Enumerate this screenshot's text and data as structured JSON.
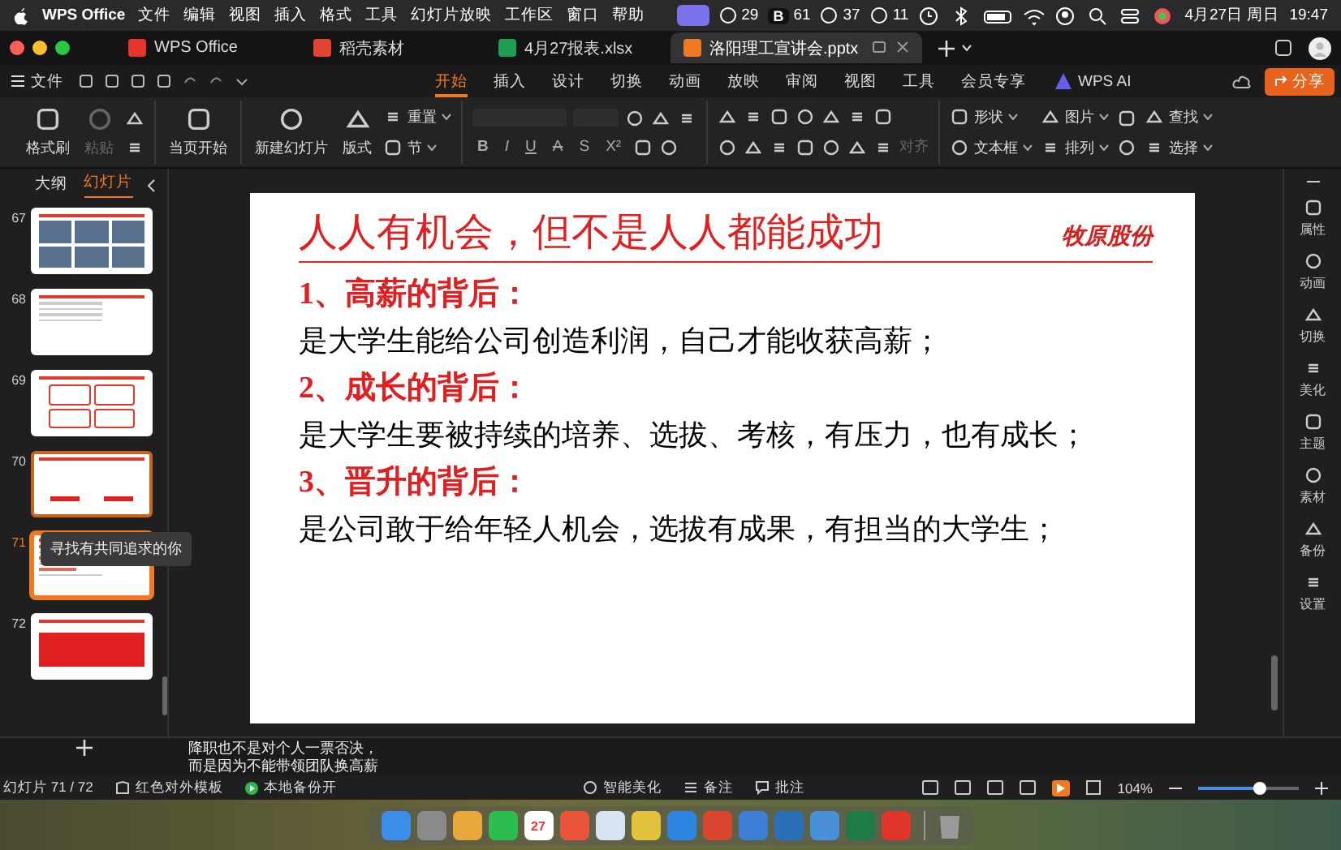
{
  "menubar": {
    "app": "WPS Office",
    "menus": [
      "文件",
      "编辑",
      "视图",
      "插入",
      "格式",
      "工具",
      "幻灯片放映",
      "工作区",
      "窗口",
      "帮助"
    ],
    "status_items": [
      {
        "text": "29"
      },
      {
        "label": "B",
        "text": "61"
      },
      {
        "text": "37"
      },
      {
        "text": "11"
      }
    ],
    "date": "4月27日 周日",
    "time": "19:47"
  },
  "doc_tabs": [
    {
      "label": "WPS Office",
      "selected": false,
      "color": "#e8352b"
    },
    {
      "label": "稻壳素材",
      "selected": false,
      "color": "#e2452f"
    },
    {
      "label": "4月27报表.xlsx",
      "selected": false,
      "color": "#1f9d55"
    },
    {
      "label": "洛阳理工宣讲会.pptx",
      "selected": true,
      "color": "#f07a22"
    }
  ],
  "ribbon": {
    "file_menu": "文件",
    "tabs": [
      {
        "label": "开始",
        "selected": true
      },
      {
        "label": "插入",
        "selected": false
      },
      {
        "label": "设计",
        "selected": false
      },
      {
        "label": "切换",
        "selected": false
      },
      {
        "label": "动画",
        "selected": false
      },
      {
        "label": "放映",
        "selected": false
      },
      {
        "label": "审阅",
        "selected": false
      },
      {
        "label": "视图",
        "selected": false
      },
      {
        "label": "工具",
        "selected": false
      },
      {
        "label": "会员专享",
        "selected": false
      }
    ],
    "ai": "WPS AI",
    "share": "分享"
  },
  "toolbar": [
    {
      "tools": [
        {
          "kind": "big",
          "label": "格式刷",
          "disabled": false
        },
        {
          "kind": "big",
          "label": "粘贴",
          "disabled": true
        },
        {
          "kind": "icons"
        }
      ]
    },
    {
      "tools": [
        {
          "kind": "big",
          "label": "当页开始",
          "disabled": false
        }
      ]
    },
    {
      "tools": [
        {
          "kind": "big",
          "label": "新建幻灯片",
          "disabled": false
        },
        {
          "kind": "big",
          "label": "版式",
          "disabled": false
        },
        {
          "kind": "pair",
          "items": [
            {
              "label": "重置",
              "disabled": false
            },
            {
              "label": "节",
              "disabled": false
            }
          ]
        }
      ]
    },
    {
      "tools": [
        {
          "kind": "font",
          "buttons": [
            "B",
            "I",
            "U",
            "A",
            "S",
            "X²"
          ]
        }
      ]
    },
    {
      "tools": [
        {
          "kind": "paragraph",
          "label": "对齐",
          "disabled": true
        }
      ]
    },
    {
      "tools": [
        {
          "kind": "pair",
          "items": [
            {
              "label": "形状",
              "disabled": false
            },
            {
              "label": "文本框",
              "disabled": false
            }
          ]
        },
        {
          "kind": "pair",
          "items": [
            {
              "label": "图片",
              "disabled": false
            },
            {
              "label": "排列",
              "disabled": false
            }
          ]
        },
        {
          "kind": "icons"
        },
        {
          "kind": "pair",
          "items": [
            {
              "label": "查找",
              "disabled": false
            },
            {
              "label": "选择",
              "disabled": false
            }
          ]
        }
      ]
    }
  ],
  "slide_panel": {
    "tabs": [
      {
        "label": "大纲",
        "selected": false
      },
      {
        "label": "幻灯片",
        "selected": true
      }
    ],
    "slides": [
      {
        "number": "67",
        "kind": "photos",
        "selected": false,
        "hovered": false
      },
      {
        "number": "68",
        "kind": "list",
        "selected": false,
        "hovered": false
      },
      {
        "number": "69",
        "kind": "grid",
        "selected": false,
        "hovered": false
      },
      {
        "number": "70",
        "kind": "icons",
        "selected": false,
        "hovered": true
      },
      {
        "number": "71",
        "kind": "text",
        "selected": true,
        "hovered": false
      },
      {
        "number": "72",
        "kind": "banner",
        "selected": false,
        "hovered": false
      }
    ],
    "tooltip": "寻找有共同追求的你"
  },
  "slide": {
    "title": "人人有机会，但不是人人都能成功",
    "brand": "牧原股份",
    "points": [
      {
        "heading": "1、高薪的背后：",
        "body": "是大学生能给公司创造利润，自己才能收获高薪；"
      },
      {
        "heading": "2、成长的背后：",
        "body": "是大学生要被持续的培养、选拔、考核，有压力，也有成长；"
      },
      {
        "heading": "3、晋升的背后：",
        "body": "是公司敢于给年轻人机会，选拔有成果，有担当的大学生；"
      }
    ]
  },
  "side_tools": [
    "属性",
    "动画",
    "切换",
    "美化",
    "主题",
    "素材",
    "备份",
    "设置"
  ],
  "notes": [
    "降职也不是对个人一票否决，",
    "而是因为不能带领团队换高薪"
  ],
  "status_bar": {
    "slide_count": "幻灯片 71 / 72",
    "template": "红色对外模板",
    "backup": "本地备份开",
    "beautify": "智能美化",
    "notes": "备注",
    "comments": "批注",
    "zoom": {
      "reading": "104%",
      "level": 0.62
    }
  },
  "dock": [
    {
      "kind": "app",
      "color": "#3b8ee8"
    },
    {
      "kind": "app",
      "color": "#8a8a8a"
    },
    {
      "kind": "app",
      "color": "#e6a93a"
    },
    {
      "kind": "app",
      "color": "#2bbd4e"
    },
    {
      "kind": "calendar",
      "color": "#ffffff",
      "text": "27"
    },
    {
      "kind": "app",
      "color": "#e8553a"
    },
    {
      "kind": "app",
      "color": "#d8e4f2"
    },
    {
      "kind": "app",
      "color": "#e2c23c"
    },
    {
      "kind": "app",
      "color": "#2f86e0"
    },
    {
      "kind": "app",
      "color": "#d9472f"
    },
    {
      "kind": "app",
      "color": "#3d7fd6"
    },
    {
      "kind": "app",
      "color": "#2a6fb8"
    },
    {
      "kind": "app",
      "color": "#4a90d9"
    },
    {
      "kind": "app",
      "color": "#1e7b45"
    },
    {
      "kind": "app",
      "color": "#e0352b"
    },
    {
      "kind": "trash",
      "color": "#9a9a9a"
    }
  ]
}
